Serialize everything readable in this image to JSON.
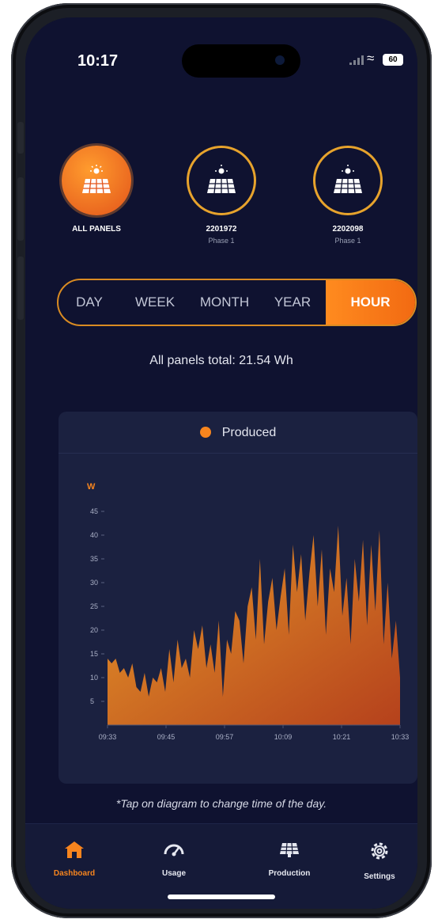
{
  "status": {
    "time": "10:17",
    "battery": "60"
  },
  "panels": [
    {
      "name": "ALL PANELS",
      "sub": "",
      "active": true
    },
    {
      "name": "2201972",
      "sub": "Phase 1",
      "active": false
    },
    {
      "name": "2202098",
      "sub": "Phase 1",
      "active": false
    }
  ],
  "tabs": [
    "DAY",
    "WEEK",
    "MONTH",
    "YEAR",
    "HOUR"
  ],
  "active_tab": "HOUR",
  "total_text": "All panels total: 21.54 Wh",
  "legend_label": "Produced",
  "note": "*Tap on diagram to change time of the day.",
  "colors": {
    "accent": "#f7851e",
    "background": "#0f1230",
    "card": "#1b2140",
    "area_top": "#e79a2a",
    "area_bottom": "#b5411c"
  },
  "nav": [
    {
      "label": "Dashboard",
      "icon": "home-icon",
      "active": true
    },
    {
      "label": "Usage",
      "icon": "gauge-icon",
      "active": false
    },
    {
      "label": "Production",
      "icon": "solar-panel-icon",
      "active": false
    },
    {
      "label": "Settings",
      "icon": "gear-icon",
      "active": false
    }
  ],
  "chart_data": {
    "type": "area",
    "ylabel": "W",
    "yticks": [
      5,
      10,
      15,
      20,
      25,
      30,
      35,
      40,
      45
    ],
    "ylim": [
      0,
      48
    ],
    "x_tick_labels": [
      "09:33",
      "09:45",
      "09:57",
      "10:09",
      "10:21",
      "10:33"
    ],
    "series": [
      {
        "name": "Produced",
        "values": [
          14,
          13,
          14,
          11,
          12,
          10,
          13,
          8,
          7,
          11,
          6,
          10,
          9,
          12,
          7,
          16,
          9,
          18,
          12,
          14,
          10,
          20,
          16,
          21,
          12,
          17,
          11,
          22,
          6,
          18,
          15,
          24,
          22,
          13,
          25,
          29,
          18,
          35,
          17,
          26,
          31,
          20,
          27,
          33,
          19,
          38,
          28,
          36,
          22,
          32,
          40,
          25,
          37,
          19,
          33,
          28,
          42,
          23,
          31,
          17,
          35,
          26,
          39,
          21,
          38,
          24,
          41,
          17,
          30,
          14,
          22,
          10
        ]
      }
    ],
    "legend": "top-center",
    "grid": false
  }
}
